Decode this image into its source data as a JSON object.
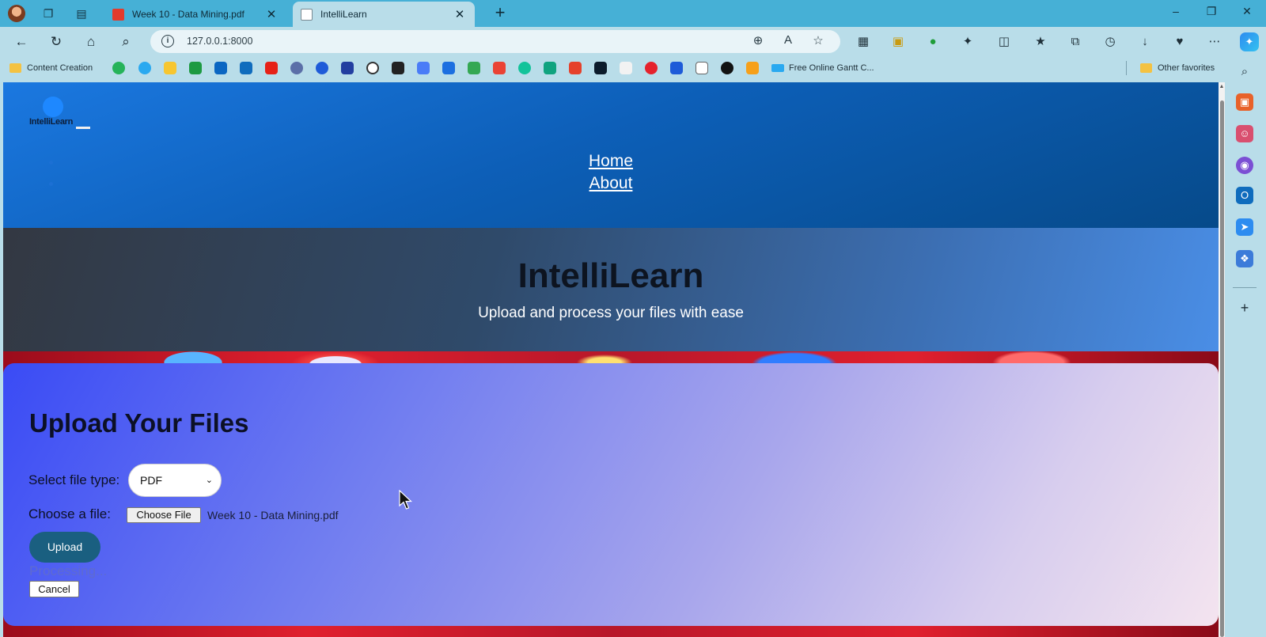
{
  "browser": {
    "tabs": [
      {
        "title": "Week 10 - Data Mining.pdf",
        "active": false
      },
      {
        "title": "IntelliLearn",
        "active": true
      }
    ],
    "address_bar": {
      "url": "127.0.0.1:8000"
    },
    "favorites": {
      "content_creation": "Content Creation",
      "gantt": "Free Online Gantt C...",
      "other": "Other favorites"
    }
  },
  "site": {
    "logo_text": "IntelliLearn",
    "nav": {
      "home": "Home",
      "about": "About"
    },
    "hero": {
      "title": "IntelliLearn",
      "subtitle": "Upload and process your files with ease"
    },
    "upload": {
      "title": "Upload Your Files",
      "file_type_label": "Select file type:",
      "file_type_value": "PDF",
      "choose_label": "Choose a file:",
      "choose_button": "Choose File",
      "chosen_file": "Week 10 - Data Mining.pdf",
      "upload_button": "Upload",
      "status": "Processing...",
      "cancel_button": "Cancel"
    }
  },
  "colors": {
    "header_blue": "#0d5fb8",
    "upload_button": "#1a5f80",
    "tabbar": "#46b0d6"
  }
}
